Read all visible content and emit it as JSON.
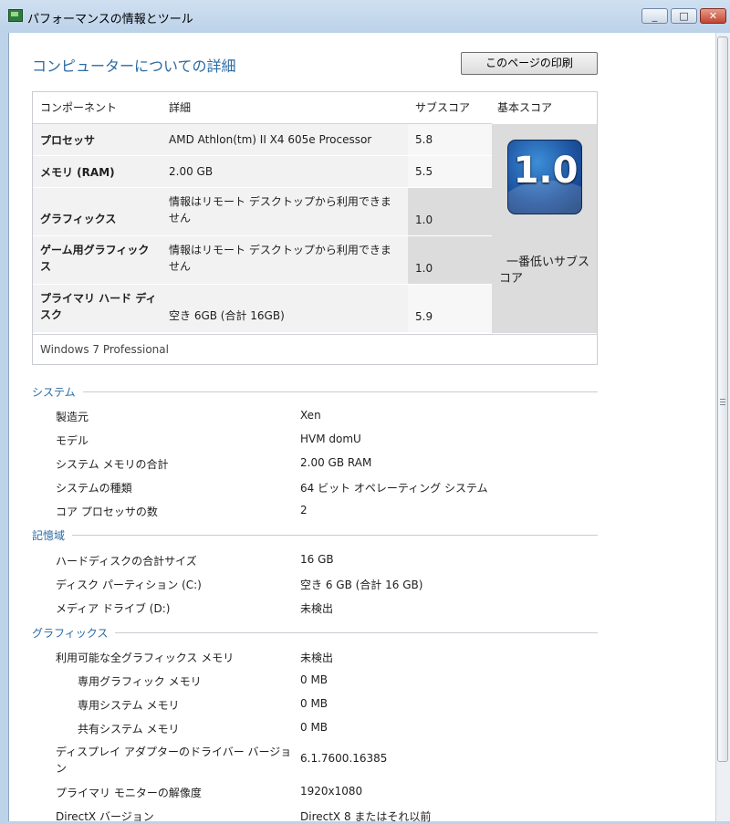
{
  "window": {
    "title": "パフォーマンスの情報とツール"
  },
  "header": {
    "title": "コンピューターについての詳細",
    "print_button": "このページの印刷"
  },
  "score_table": {
    "columns": [
      "コンポーネント",
      "詳細",
      "サブスコア",
      "基本スコア"
    ],
    "rows": [
      {
        "component": "プロセッサ",
        "detail": "AMD Athlon(tm) II X4 605e Processor",
        "subscore": "5.8"
      },
      {
        "component": "メモリ (RAM)",
        "detail": "2.00 GB",
        "subscore": "5.5"
      },
      {
        "component": "グラフィックス",
        "detail": "情報はリモート デスクトップから利用できません",
        "subscore": "1.0"
      },
      {
        "component": "ゲーム用グラフィックス",
        "detail": "情報はリモート デスクトップから利用できません",
        "subscore": "1.0"
      },
      {
        "component": "プライマリ ハード ディスク",
        "detail": "空き 6GB (合計 16GB)",
        "subscore": "5.9"
      }
    ],
    "base_score": "1.0",
    "base_score_label": "一番低いサブスコア",
    "os": "Windows 7 Professional"
  },
  "system": {
    "heading": "システム",
    "items": [
      {
        "label": "製造元",
        "value": "Xen"
      },
      {
        "label": "モデル",
        "value": "HVM domU"
      },
      {
        "label": "システム メモリの合計",
        "value": "2.00 GB RAM"
      },
      {
        "label": "システムの種類",
        "value": "64 ビット オペレーティング システム"
      },
      {
        "label": "コア プロセッサの数",
        "value": "2"
      }
    ]
  },
  "storage": {
    "heading": "記憶域",
    "items": [
      {
        "label": "ハードディスクの合計サイズ",
        "value": "16 GB"
      },
      {
        "label": "ディスク パーティション (C:)",
        "value": "空き 6 GB (合計 16 GB)"
      },
      {
        "label": "メディア ドライブ (D:)",
        "value": "未検出"
      }
    ]
  },
  "graphics": {
    "heading": "グラフィックス",
    "items": [
      {
        "label": "利用可能な全グラフィックス メモリ",
        "value": "未検出"
      },
      {
        "label": "専用グラフィック メモリ",
        "value": "0 MB"
      },
      {
        "label": "専用システム メモリ",
        "value": "0 MB"
      },
      {
        "label": "共有システム メモリ",
        "value": "0 MB"
      },
      {
        "label": "ディスプレイ アダプターのドライバー バージョン",
        "value": "6.1.7600.16385"
      },
      {
        "label": "プライマリ モニターの解像度",
        "value": "1920x1080"
      },
      {
        "label": "DirectX バージョン",
        "value": "DirectX 8 またはそれ以前"
      }
    ]
  }
}
